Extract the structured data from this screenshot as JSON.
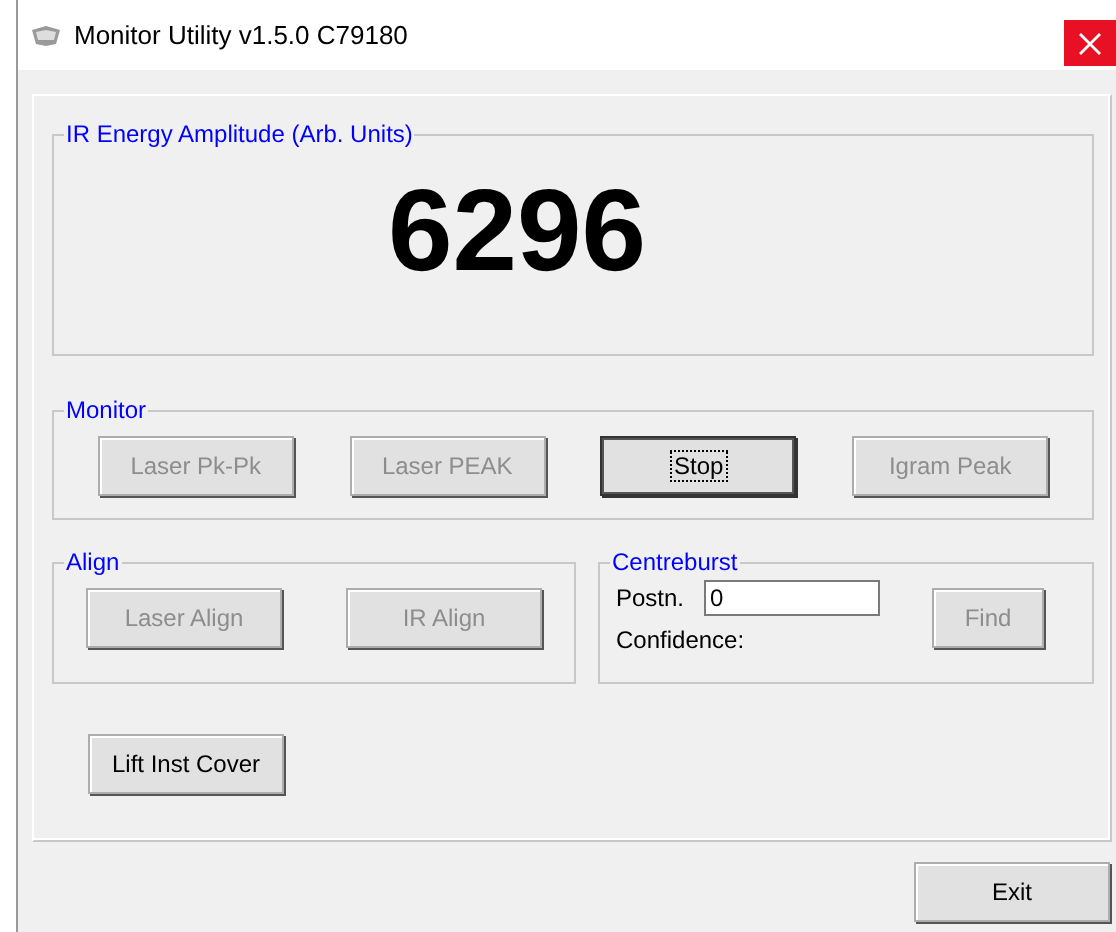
{
  "window": {
    "title": "Monitor Utility v1.5.0 C79180"
  },
  "amplitude": {
    "label": "IR Energy Amplitude (Arb. Units)",
    "value": "6296"
  },
  "monitor": {
    "label": "Monitor",
    "buttons": [
      {
        "label": "Laser Pk-Pk",
        "disabled": true,
        "focused": false
      },
      {
        "label": "Laser PEAK",
        "disabled": true,
        "focused": false
      },
      {
        "label": "Stop",
        "disabled": false,
        "focused": true
      },
      {
        "label": "Igram Peak",
        "disabled": true,
        "focused": false
      }
    ]
  },
  "align": {
    "label": "Align",
    "buttons": [
      {
        "label": "Laser Align",
        "disabled": true,
        "focused": false
      },
      {
        "label": "IR Align",
        "disabled": true,
        "focused": false
      }
    ]
  },
  "centreburst": {
    "label": "Centreburst",
    "position_label": "Postn.",
    "position_value": "0",
    "confidence_label": "Confidence:",
    "find_button": {
      "label": "Find",
      "disabled": true,
      "focused": false
    }
  },
  "lift_button": {
    "label": "Lift Inst Cover",
    "disabled": false,
    "focused": false
  },
  "exit_button": {
    "label": "Exit",
    "disabled": false,
    "focused": false
  }
}
